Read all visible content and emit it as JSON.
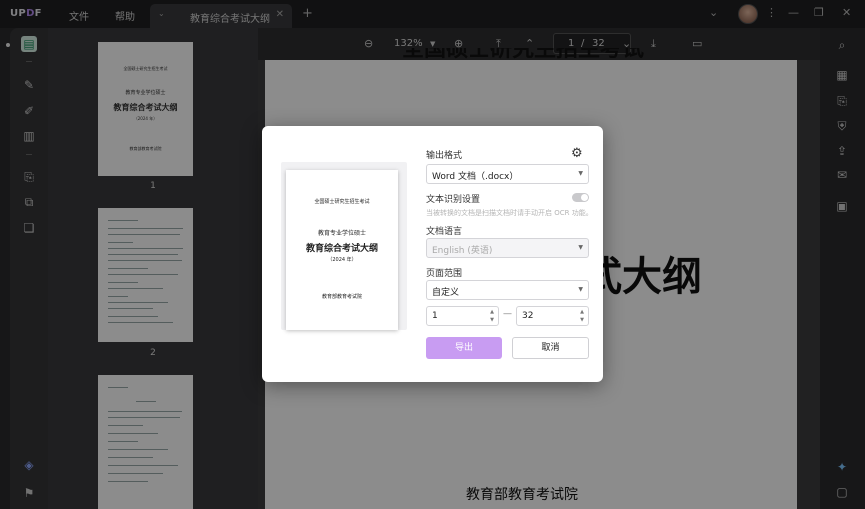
{
  "app": {
    "logo_prefix": "UP",
    "logo_accent": "D",
    "logo_suffix": "F",
    "menu": [
      "文件",
      "帮助"
    ],
    "tab_title": "教育综合考试大纲",
    "accent_color": "#c89cf2"
  },
  "toolbar": {
    "zoom": "132%",
    "current_page": "1",
    "page_sep": "/",
    "total_pages": "32"
  },
  "thumbnails": {
    "page1": {
      "line1": "全国硕士研究生招生考试",
      "line2": "教育专业学位硕士",
      "line3": "教育综合考试大纲",
      "line4": "（2024 年）",
      "line5": "教育部教育考试院"
    },
    "labels": [
      "1",
      "2"
    ]
  },
  "document": {
    "top_text": "全国硕士研究生招生考试",
    "text_partial_1": "顷士",
    "text_partial_2": "式大纲",
    "bottom_text": "教育部教育考试院"
  },
  "dialog": {
    "output_format_label": "输出格式",
    "output_format_value": "Word 文档（.docx）",
    "ocr_label": "文本识别设置",
    "ocr_hint": "当被转换的文档是扫描文档时请手动开启 OCR 功能。",
    "doc_lang_label": "文档语言",
    "doc_lang_value": "English (英语)",
    "page_range_label": "页面范围",
    "page_range_value": "自定义",
    "range_from": "1",
    "range_to": "32",
    "range_dash": "—",
    "export_label": "导出",
    "cancel_label": "取消",
    "preview": {
      "line1": "全国硕士研究生招生考试",
      "line2": "教育专业学位硕士",
      "line3": "教育综合考试大纲",
      "line4": "（2024 年）",
      "line5": "教育部教育考试院"
    }
  }
}
